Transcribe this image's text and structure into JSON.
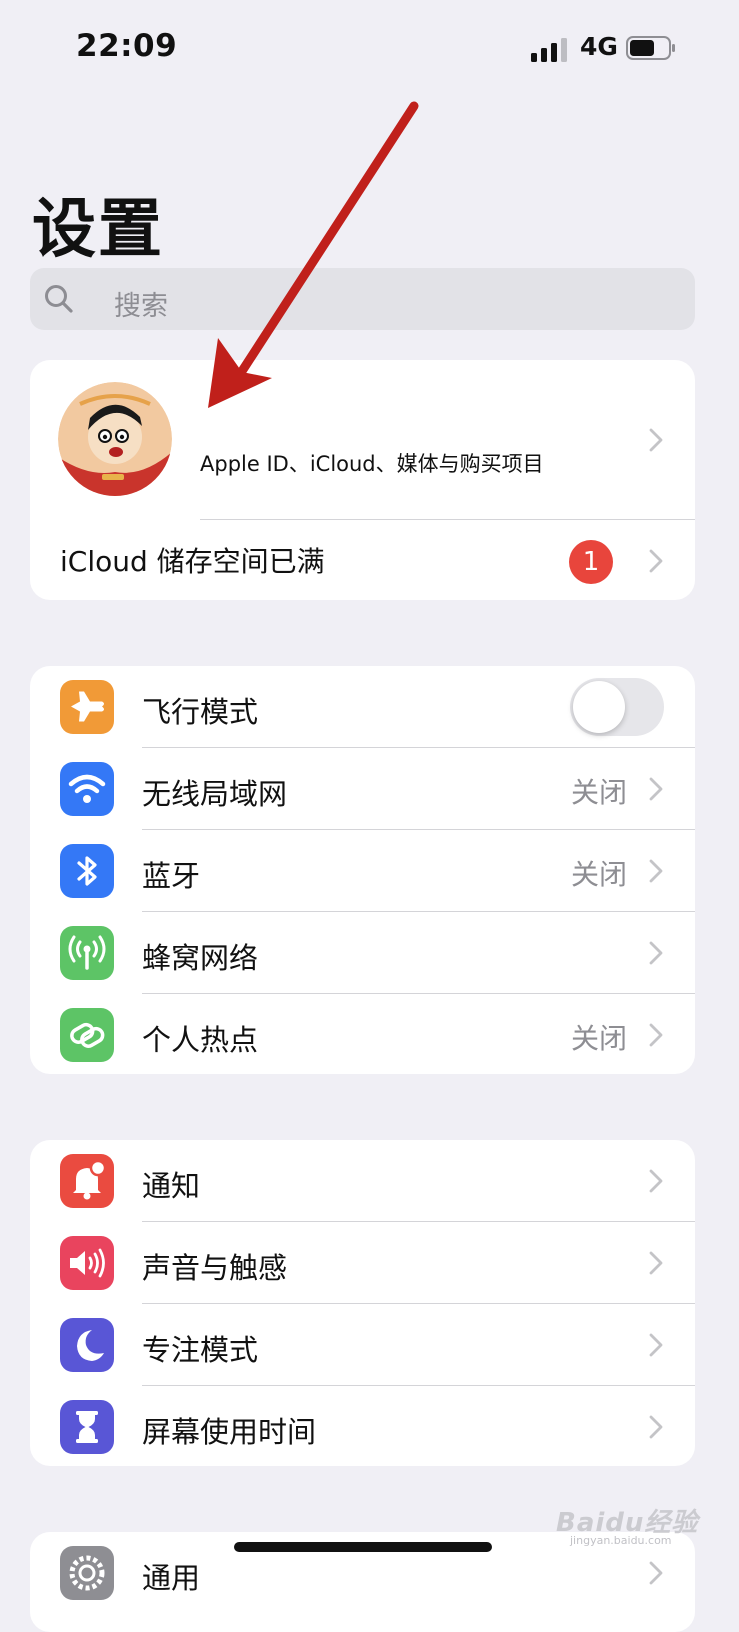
{
  "status_bar": {
    "time": "22:09",
    "network": "4G"
  },
  "page": {
    "title": "设置"
  },
  "search": {
    "placeholder": "搜索"
  },
  "account": {
    "subtitle": "Apple ID、iCloud、媒体与购买项目",
    "storage_label": "iCloud 储存空间已满",
    "storage_badge": "1"
  },
  "connectivity": {
    "items": [
      {
        "label": "飞行模式",
        "icon": "airplane-icon",
        "color": "#f19a37",
        "toggle": false
      },
      {
        "label": "无线局域网",
        "value": "关闭",
        "icon": "wifi-icon",
        "color": "#3478f6"
      },
      {
        "label": "蓝牙",
        "value": "关闭",
        "icon": "bluetooth-icon",
        "color": "#3478f6"
      },
      {
        "label": "蜂窝网络",
        "icon": "cellular-icon",
        "color": "#5dc466"
      },
      {
        "label": "个人热点",
        "value": "关闭",
        "icon": "hotspot-icon",
        "color": "#5dc466"
      }
    ]
  },
  "notifications": {
    "items": [
      {
        "label": "通知",
        "icon": "notification-bell-icon",
        "color": "#ea4b40"
      },
      {
        "label": "声音与触感",
        "icon": "speaker-icon",
        "color": "#e9445e"
      },
      {
        "label": "专注模式",
        "icon": "moon-icon",
        "color": "#5956d6"
      },
      {
        "label": "屏幕使用时间",
        "icon": "hourglass-icon",
        "color": "#5956d6"
      }
    ]
  },
  "general": {
    "items": [
      {
        "label": "通用",
        "icon": "gear-icon",
        "color": "#8e8e93"
      }
    ]
  },
  "watermark": {
    "text": "Baidu经验",
    "sub": "jingyan.baidu.com"
  }
}
